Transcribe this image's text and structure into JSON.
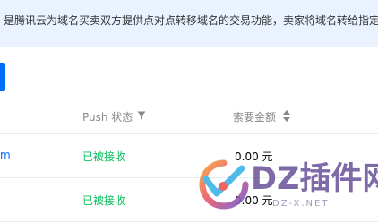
{
  "notice": {
    "text": "是腾讯云为域名买卖双方提供点对点转移域名的交易功能，卖家将域名转给指定的"
  },
  "table": {
    "columns": {
      "push_status": "Push 状态",
      "amount": "索要金额"
    },
    "rows": [
      {
        "domain_fragment": "m",
        "status": "已被接收",
        "amount": "0.00 元"
      },
      {
        "domain_fragment": "",
        "status": "已被接收",
        "amount": "0.00 元"
      }
    ]
  },
  "watermark": {
    "brand": "DZ插件网",
    "url": "DZ-X.NET"
  },
  "colors": {
    "banner_bg": "#eaf2ff",
    "primary": "#006eff",
    "success": "#0abf5b",
    "header_text": "#888888",
    "watermark": "#6f5a9d"
  },
  "icons": {
    "filter": "filter-icon",
    "sort": "sort-icon",
    "watermark_logo": "dz-logo-icon"
  }
}
